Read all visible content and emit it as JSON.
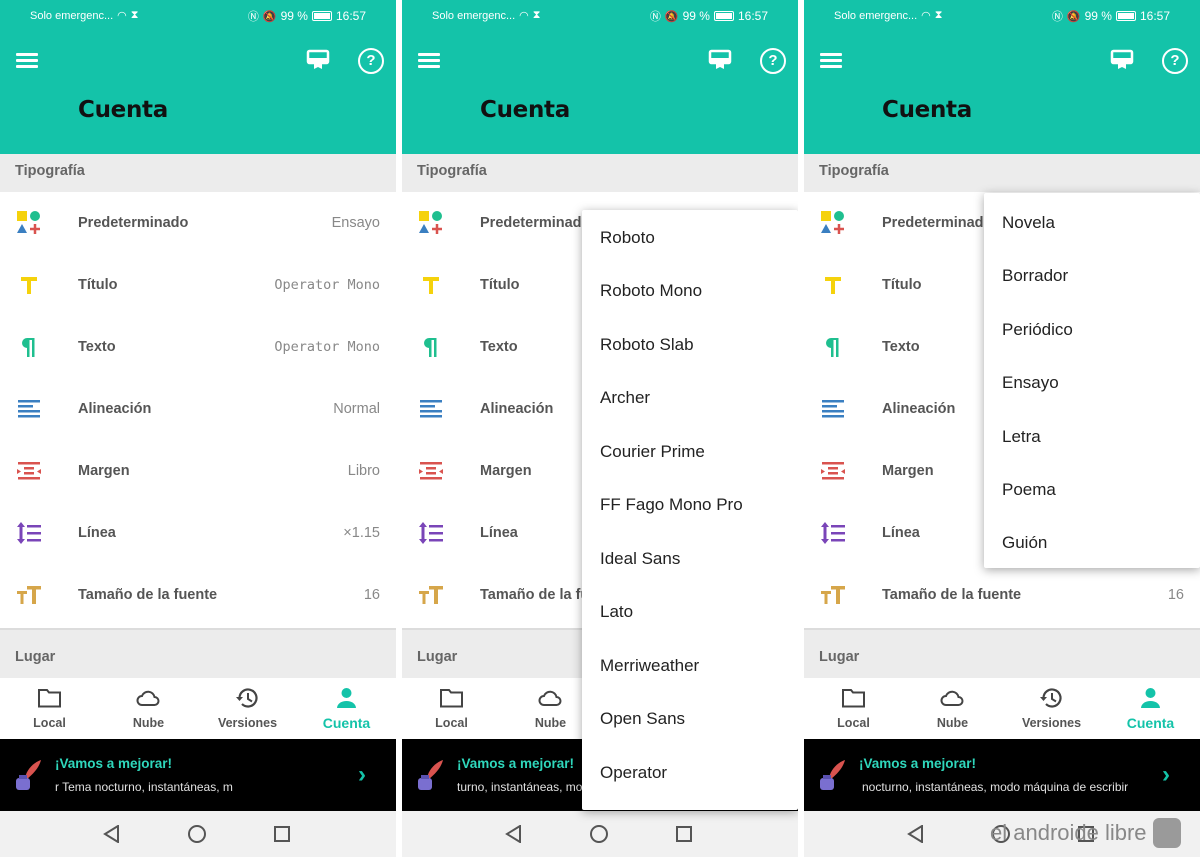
{
  "status": {
    "carrier": "Solo emergenc...",
    "battery": "99 %",
    "time": "16:57"
  },
  "header": {
    "title": "Cuenta"
  },
  "sections": {
    "typography": "Tipografía",
    "place": "Lugar"
  },
  "rows": [
    {
      "label": "Predeterminado",
      "value": "Ensayo"
    },
    {
      "label": "Título",
      "value": "Operator Mono"
    },
    {
      "label": "Texto",
      "value": "Operator Mono"
    },
    {
      "label": "Alineación",
      "value": "Normal"
    },
    {
      "label": "Margen",
      "value": "Libro"
    },
    {
      "label": "Línea",
      "value": "×1.15"
    },
    {
      "label": "Tamaño de la fuente",
      "value": "16"
    }
  ],
  "nav": [
    {
      "label": "Local"
    },
    {
      "label": "Nube"
    },
    {
      "label": "Versiones"
    },
    {
      "label": "Cuenta"
    }
  ],
  "promo": {
    "title": "¡Vamos a mejorar!",
    "text1": "r            Tema nocturno, instantáneas, m",
    "text2": "turno, instantáneas, modo máquina de escribir",
    "text3": "nocturno, instantáneas, modo máquina de escribir"
  },
  "font_options": [
    "Roboto",
    "Roboto Mono",
    "Roboto Slab",
    "Archer",
    "Courier Prime",
    "FF Fago Mono Pro",
    "Ideal Sans",
    "Lato",
    "Merriweather",
    "Open Sans",
    "Operator"
  ],
  "style_options": [
    "Novela",
    "Borrador",
    "Periódico",
    "Ensayo",
    "Letra",
    "Poema",
    "Guión"
  ],
  "watermark": "el androide libre",
  "colors": {
    "accent": "#14c3a9",
    "promo_bg": "#000000",
    "icon_yellow": "#f5d20c",
    "icon_green": "#1fbf8f",
    "icon_blue": "#3a7fc1",
    "icon_red": "#d9534f",
    "icon_purple": "#7a45b8",
    "icon_gold": "#d6a64a"
  }
}
